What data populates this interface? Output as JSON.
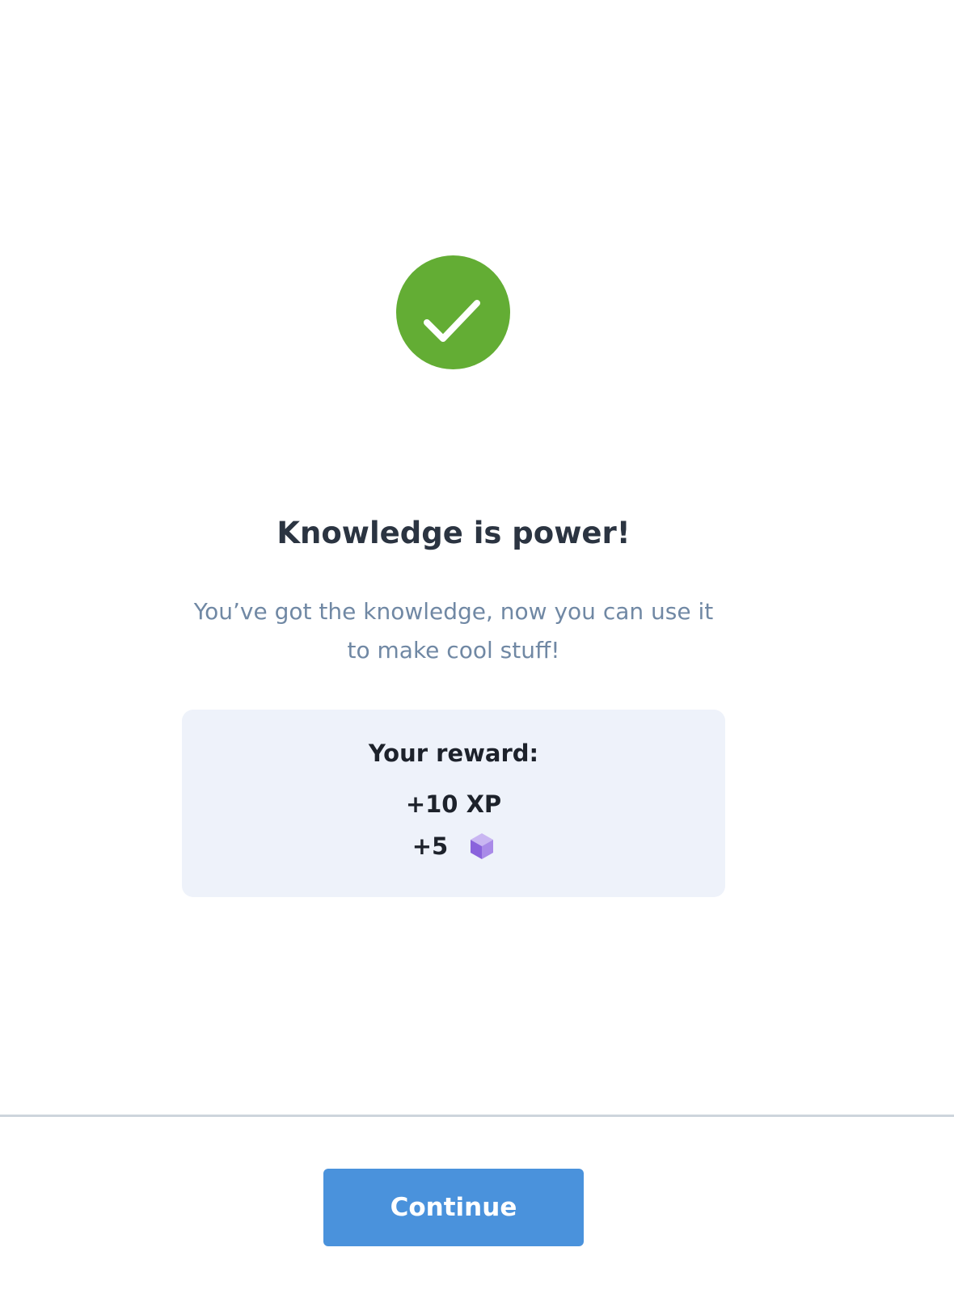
{
  "icons": {
    "success": "check-circle-icon",
    "gem": "purple-cube-icon"
  },
  "colors": {
    "success_green": "#63ad34",
    "title": "#2b3441",
    "subtitle": "#7088a4",
    "card_bg": "#eef2fa",
    "button_bg": "#4a92dc",
    "gem_purple": "#8a63dc"
  },
  "result": {
    "title": "Knowledge is power!",
    "message": "You’ve got the knowledge, now you can use it to make cool stuff!"
  },
  "reward": {
    "label": "Your reward:",
    "xp": "+10 XP",
    "gems": "+5"
  },
  "footer": {
    "continue_label": "Continue"
  }
}
